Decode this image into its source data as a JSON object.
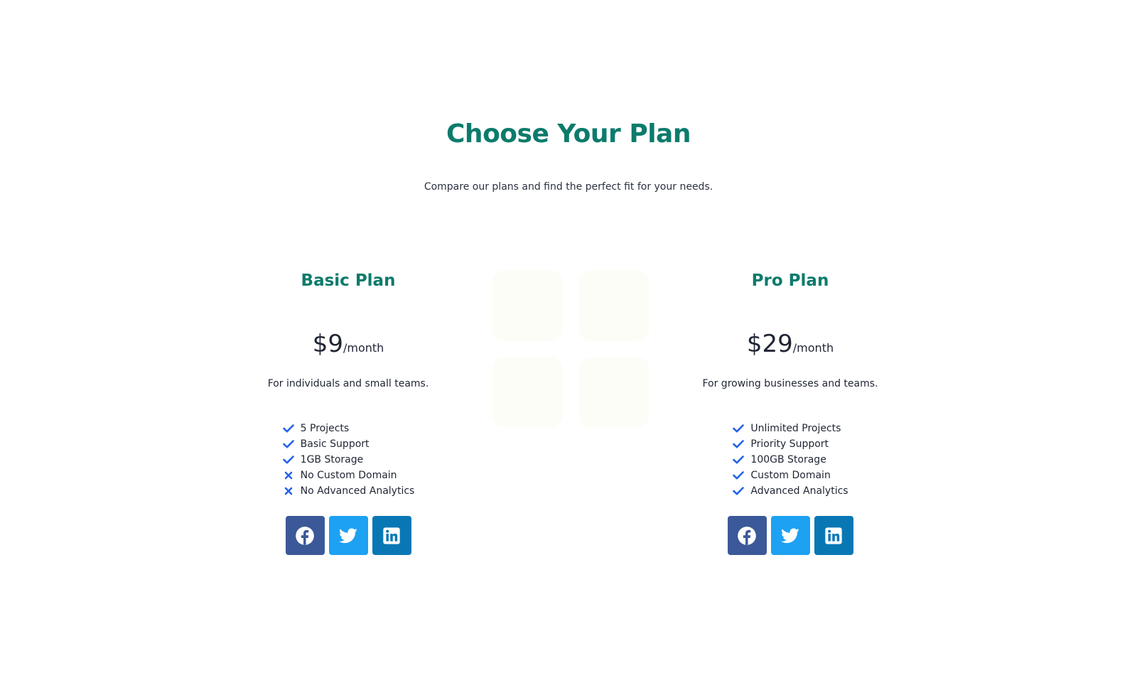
{
  "header": {
    "title": "Choose Your Plan",
    "subtitle": "Compare our plans and find the perfect fit for your needs."
  },
  "colors": {
    "accent": "#0c7b6c",
    "text": "#1f2533",
    "icon_blue": "#2563eb",
    "facebook": "#3b5998",
    "twitter": "#1da1f2",
    "linkedin": "#0a77b5"
  },
  "plans": [
    {
      "name": "Basic Plan",
      "price": "$9",
      "period": "/month",
      "description": "For individuals and small teams.",
      "features": [
        {
          "label": "5 Projects",
          "icon": "check-icon"
        },
        {
          "label": "Basic Support",
          "icon": "check-icon"
        },
        {
          "label": "1GB Storage",
          "icon": "check-icon"
        },
        {
          "label": "No Custom Domain",
          "icon": "x-icon"
        },
        {
          "label": "No Advanced Analytics",
          "icon": "x-icon"
        }
      ],
      "social": [
        "facebook-icon",
        "twitter-icon",
        "linkedin-icon"
      ]
    },
    {
      "name": "Pro Plan",
      "price": "$29",
      "period": "/month",
      "description": "For growing businesses and teams.",
      "features": [
        {
          "label": "Unlimited Projects",
          "icon": "check-icon"
        },
        {
          "label": "Priority Support",
          "icon": "check-icon"
        },
        {
          "label": "100GB Storage",
          "icon": "check-icon"
        },
        {
          "label": "Custom Domain",
          "icon": "check-icon"
        },
        {
          "label": "Advanced Analytics",
          "icon": "check-icon"
        }
      ],
      "social": [
        "facebook-icon",
        "twitter-icon",
        "linkedin-icon"
      ]
    }
  ]
}
